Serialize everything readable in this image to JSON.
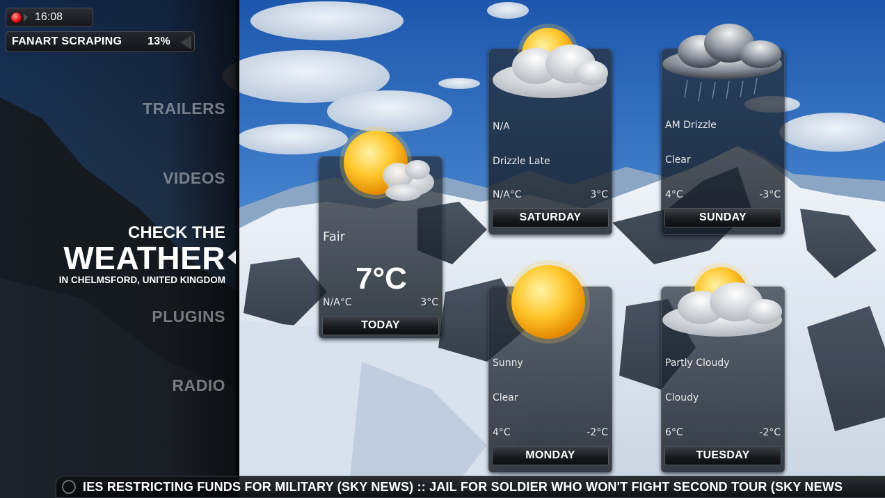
{
  "status": {
    "time": "16:08",
    "scraping_label": "FANART SCRAPING",
    "scraping_percent": "13%"
  },
  "menu": {
    "items": [
      {
        "label": "TRAILERS"
      },
      {
        "label": "VIDEOS"
      },
      {
        "label": "PLUGINS"
      },
      {
        "label": "RADIO"
      }
    ],
    "active": {
      "line1": "CHECK THE",
      "line2": "WEATHER",
      "line3": "IN CHELMSFORD, UNITED KINGDOM"
    }
  },
  "weather": {
    "today": {
      "condition": "Fair",
      "temperature": "7°C",
      "low": "N/A°C",
      "high": "3°C",
      "day": "TODAY",
      "icon": "partly-sunny-icon"
    },
    "forecast": [
      {
        "day": "SATURDAY",
        "line1": "N/A",
        "line2": "Drizzle Late",
        "low": "N/A°C",
        "high": "3°C",
        "icon": "sun-cloud-icon"
      },
      {
        "day": "SUNDAY",
        "line1": "AM Drizzle",
        "line2": "Clear",
        "low": "4°C",
        "high": "-3°C",
        "icon": "drizzle-cloud-icon"
      },
      {
        "day": "MONDAY",
        "line1": "Sunny",
        "line2": "Clear",
        "low": "4°C",
        "high": "-2°C",
        "icon": "sun-icon"
      },
      {
        "day": "TUESDAY",
        "line1": "Partly Cloudy",
        "line2": "Cloudy",
        "low": "6°C",
        "high": "-2°C",
        "icon": "sun-cloud-icon"
      }
    ]
  },
  "ticker": {
    "text": "IES RESTRICTING FUNDS FOR MILITARY (SKY NEWS) :: JAIL FOR SOLDIER WHO WON'T FIGHT SECOND TOUR (SKY NEWS"
  },
  "colors": {
    "sky": "#3b78c4",
    "snow": "#e6edf5",
    "accent_red": "#e01010"
  }
}
